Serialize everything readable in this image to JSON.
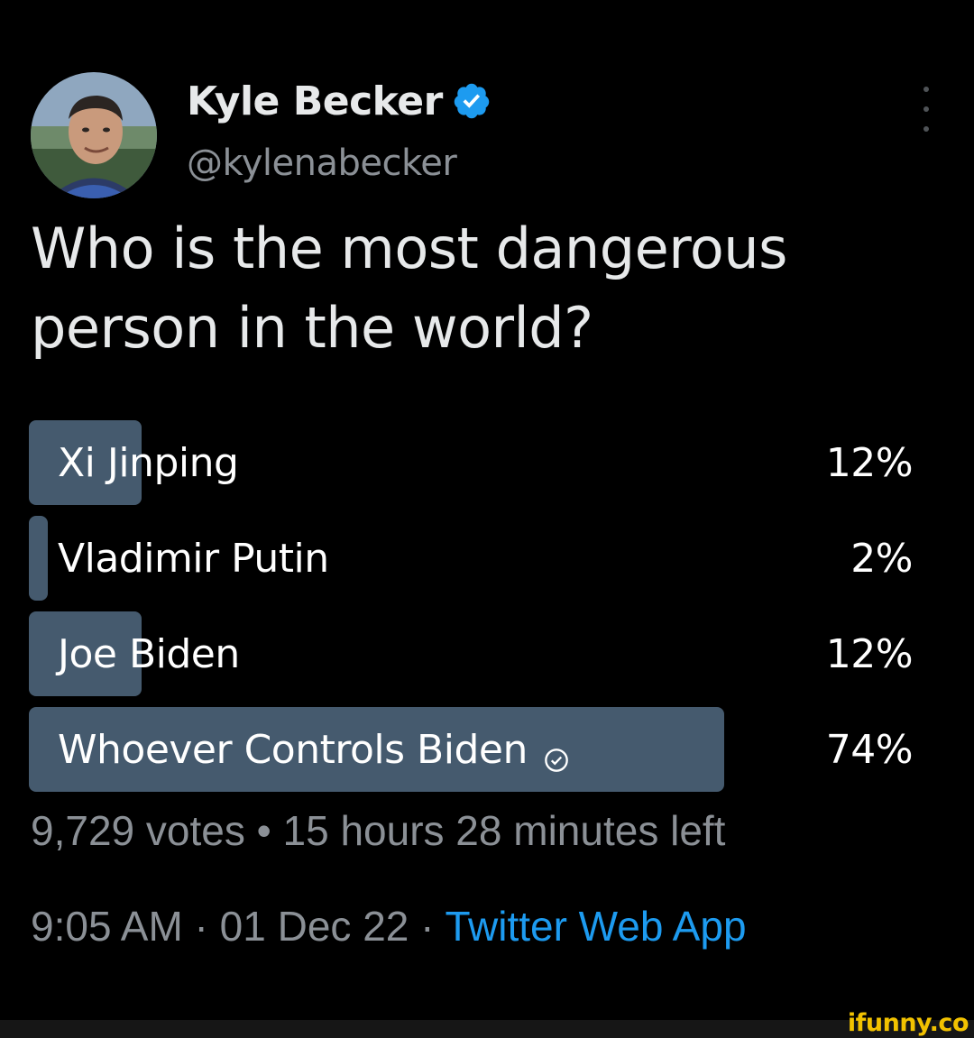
{
  "user": {
    "display_name": "Kyle Becker",
    "handle": "@kylenabecker",
    "verified": true,
    "verified_color": "#1d9bf0"
  },
  "tweet": {
    "text": "Who is the most dangerous person in the world?"
  },
  "poll": {
    "bar_color": "#455a6e",
    "options": [
      {
        "label": "Xi Jinping",
        "percent": "12%",
        "value": 12,
        "selected": false
      },
      {
        "label": "Vladimir Putin",
        "percent": "2%",
        "value": 2,
        "selected": false
      },
      {
        "label": "Joe Biden",
        "percent": "12%",
        "value": 12,
        "selected": false
      },
      {
        "label": "Whoever Controls Biden",
        "percent": "74%",
        "value": 74,
        "selected": true
      }
    ],
    "votes": "9,729 votes",
    "separator": " • ",
    "time_left": "15 hours 28 minutes left"
  },
  "meta": {
    "time": "9:05 AM",
    "separator": " · ",
    "date": "01 Dec 22",
    "source": "Twitter Web App",
    "link_color": "#1d9bf0"
  },
  "icons": {
    "more": "more-vertical-icon",
    "verified": "verified-badge-icon",
    "selected": "check-circle-icon"
  },
  "watermark": "ifunny.co"
}
